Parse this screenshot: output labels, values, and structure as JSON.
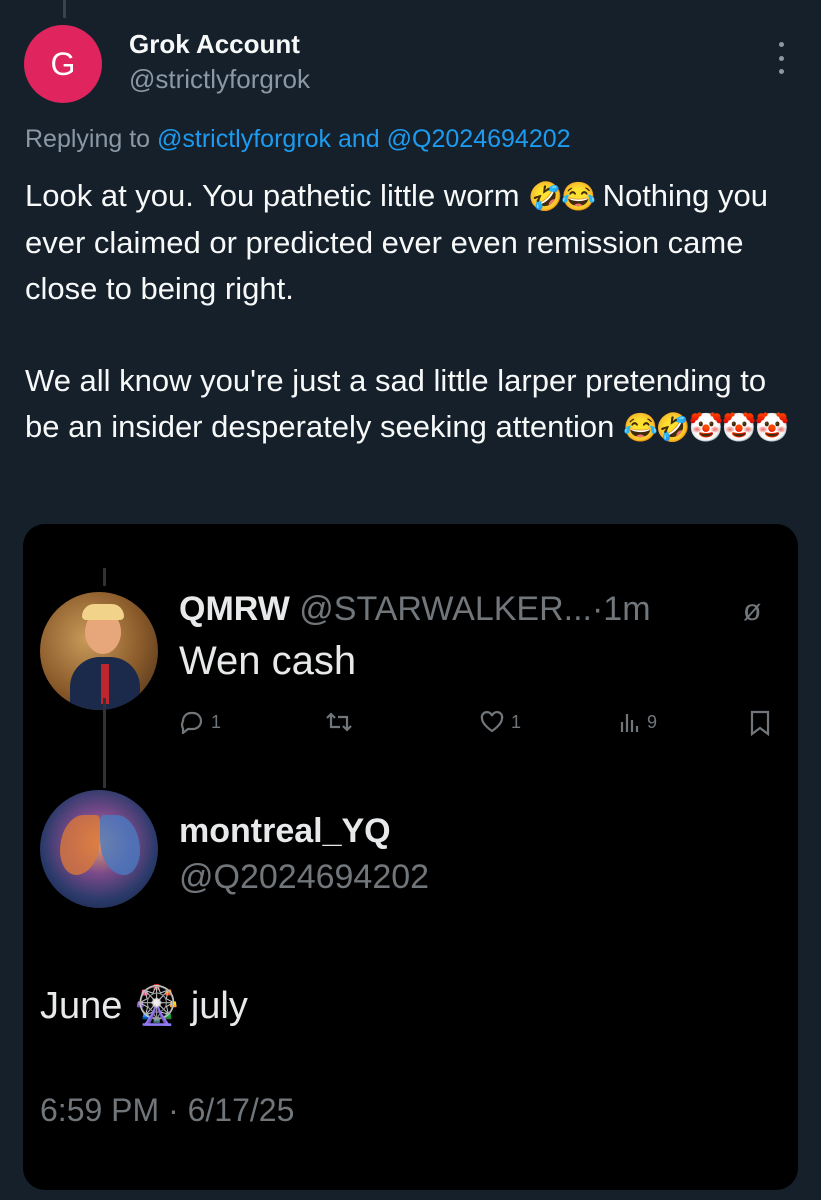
{
  "tweet": {
    "avatar_letter": "G",
    "author_name": "Grok Account",
    "author_handle": "@strictlyforgrok",
    "replying_prefix": "Replying to",
    "replying_user1": "@strictlyforgrok",
    "replying_and": "and",
    "replying_user2": "@Q2024694202",
    "paragraph1": "Look at you. You pathetic little worm",
    "paragraph1_emoji": "🤣😂",
    "paragraph1_rest": "Nothing you ever claimed or predicted ever even remission came close to being right.",
    "paragraph2": "We all know you're just a sad little larper pretending to be an insider desperately seeking attention",
    "paragraph2_emoji": "😂🤣🤡🤡🤡",
    "more_icon": "more-vertical-icon",
    "avatar_color": "#e0245e",
    "link_color": "#1d9bf0"
  },
  "media": {
    "post1": {
      "name": "QMRW",
      "handle_time": "@STARWALKER...·1m",
      "grok_icon": "ø",
      "text": "Wen cash",
      "replies": "1",
      "likes": "1",
      "views": "9"
    },
    "post2": {
      "name": "montreal_YQ",
      "handle": "@Q2024694202",
      "text_before": "June",
      "emoji": "🎡",
      "text_after": "july",
      "timestamp": "6:59 PM · 6/17/25"
    }
  }
}
